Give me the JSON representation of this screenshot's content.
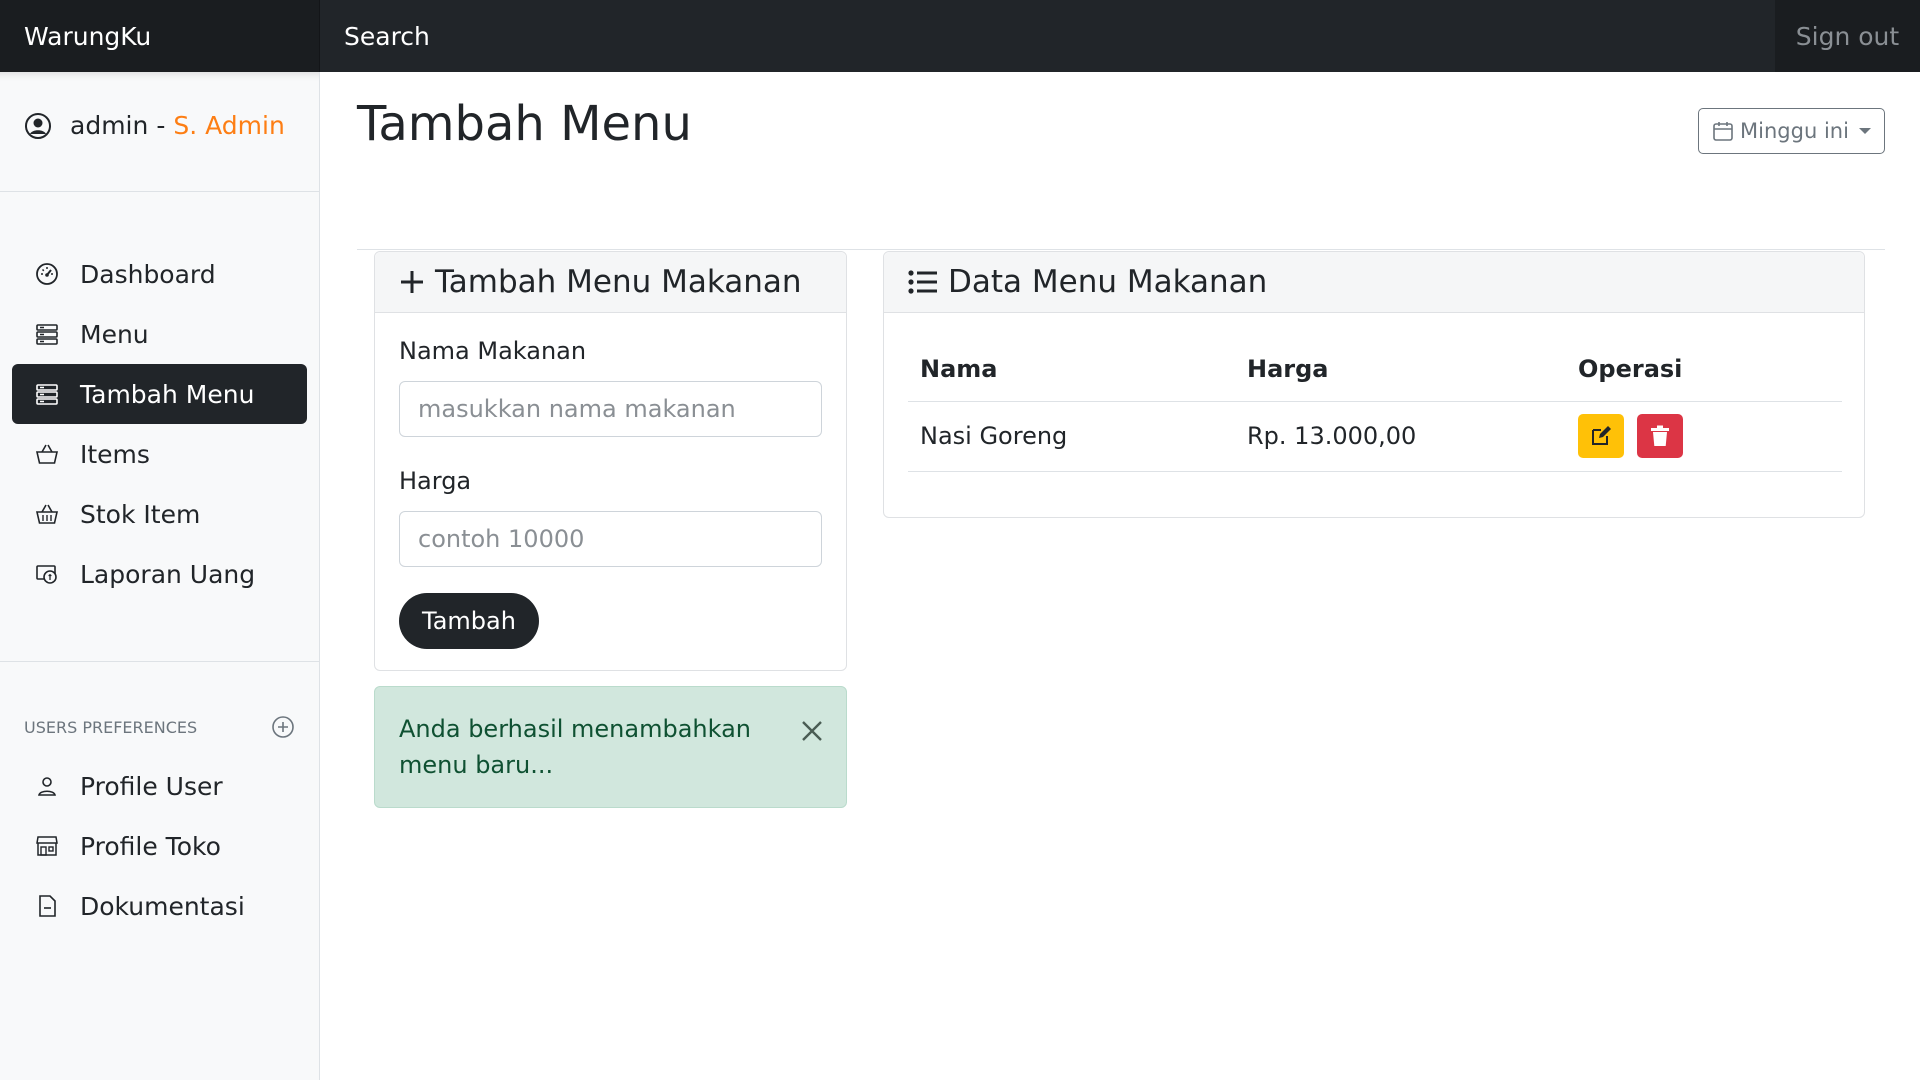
{
  "navbar": {
    "brand": "WarungKu",
    "search_placeholder": "Search",
    "signout_label": "Sign out"
  },
  "sidebar": {
    "user": {
      "name": "admin",
      "separator": "-",
      "role": "S. Admin"
    },
    "items": [
      {
        "label": "Dashboard",
        "icon": "speedometer-icon",
        "active": false
      },
      {
        "label": "Menu",
        "icon": "menu-list-icon",
        "active": false
      },
      {
        "label": "Tambah Menu",
        "icon": "menu-list-icon",
        "active": true
      },
      {
        "label": "Items",
        "icon": "basket-icon",
        "active": false
      },
      {
        "label": "Stok Item",
        "icon": "basket-stock-icon",
        "active": false
      },
      {
        "label": "Laporan Uang",
        "icon": "cash-report-icon",
        "active": false
      }
    ],
    "preferences_heading": "USERS PREFERENCES",
    "pref_items": [
      {
        "label": "Profile User",
        "icon": "person-icon"
      },
      {
        "label": "Profile Toko",
        "icon": "shop-icon"
      },
      {
        "label": "Dokumentasi",
        "icon": "file-icon"
      }
    ]
  },
  "main": {
    "title": "Tambah Menu",
    "period_button": "Minggu ini",
    "form": {
      "header": "Tambah Menu Makanan",
      "name_label": "Nama Makanan",
      "name_placeholder": "masukkan nama makanan",
      "price_label": "Harga",
      "price_placeholder": "contoh 10000",
      "submit_label": "Tambah"
    },
    "alert": {
      "message": "Anda berhasil menambahkan menu baru..."
    },
    "table": {
      "header": "Data Menu Makanan",
      "columns": [
        "Nama",
        "Harga",
        "Operasi"
      ],
      "rows": [
        {
          "nama": "Nasi Goreng",
          "harga": "Rp. 13.000,00"
        }
      ]
    }
  },
  "colors": {
    "navbar": "#212529",
    "role_accent": "#fd7e14",
    "edit_button": "#ffc107",
    "delete_button": "#dc3545",
    "alert_bg": "#d1e7dd"
  }
}
